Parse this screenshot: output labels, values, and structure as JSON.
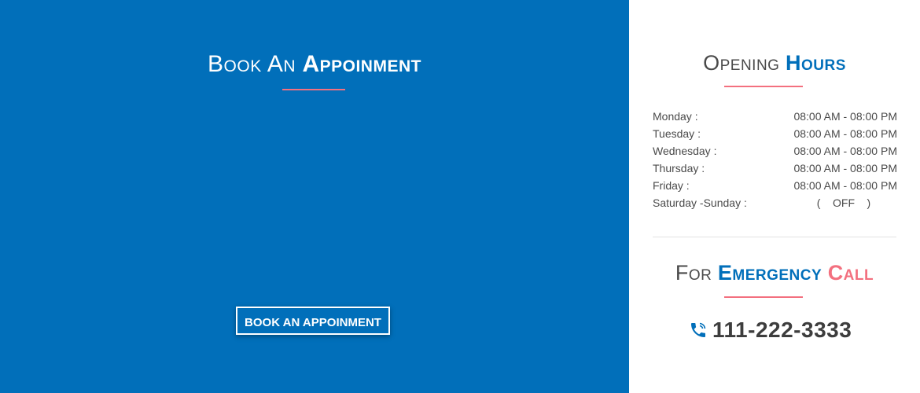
{
  "booking": {
    "title_light": "Book An",
    "title_bold": "Appoinment",
    "button_label": "BOOK AN APPOINMENT"
  },
  "hours": {
    "title_light": "Opening",
    "title_bold": "Hours",
    "rows": [
      {
        "day": "Monday :",
        "time": "08:00 AM - 08:00 PM"
      },
      {
        "day": "Tuesday :",
        "time": "08:00 AM - 08:00 PM"
      },
      {
        "day": "Wednesday :",
        "time": "08:00 AM - 08:00 PM"
      },
      {
        "day": "Thursday :",
        "time": "08:00 AM - 08:00 PM"
      },
      {
        "day": "Friday :",
        "time": "08:00 AM - 08:00 PM"
      },
      {
        "day": "Saturday -Sunday :",
        "time": "(    OFF    )"
      }
    ]
  },
  "emergency": {
    "title_light": "For",
    "title_blue": "Emergency",
    "title_pink": "Call",
    "phone": "111-222-3333",
    "icon": "phone-icon"
  },
  "colors": {
    "primary_blue": "#016fba",
    "accent_pink": "#f3707f",
    "text_dark": "#4a4a4a"
  }
}
